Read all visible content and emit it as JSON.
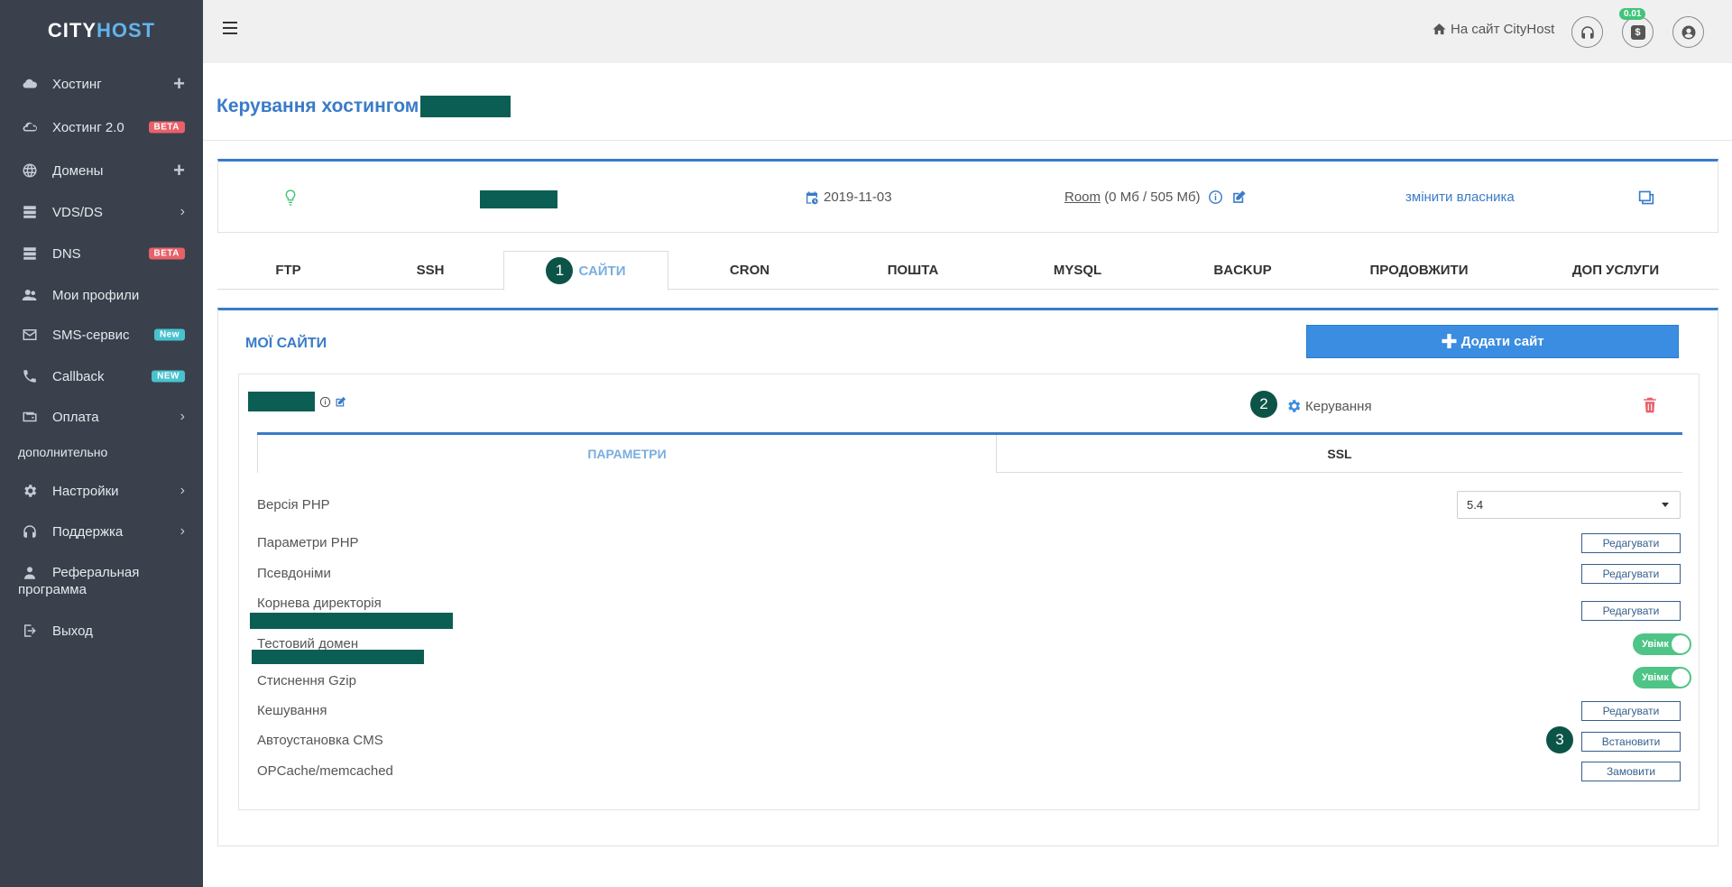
{
  "brand": {
    "part1": "CITY",
    "part2": "HOST"
  },
  "sidebar": {
    "items": [
      {
        "label": "Хостинг",
        "icon": "cloud-icon"
      },
      {
        "label": "Хостинг 2.0",
        "icon": "cloud-outline-icon",
        "badge": "BETA"
      },
      {
        "label": "Домены",
        "icon": "globe-icon"
      },
      {
        "label": "VDS/DS",
        "icon": "server-icon"
      },
      {
        "label": "DNS",
        "icon": "server-icon",
        "badge": "BETA"
      },
      {
        "label": "Мои профили",
        "icon": "users-icon"
      },
      {
        "label": "SMS-сервис",
        "icon": "envelope-icon",
        "badge": "New"
      },
      {
        "label": "Callback",
        "icon": "phone-icon",
        "badge": "NEW"
      },
      {
        "label": "Оплата",
        "icon": "wallet-icon"
      },
      {
        "label": "Настройки",
        "icon": "gear-icon"
      },
      {
        "label": "Поддержка",
        "icon": "headset-icon"
      },
      {
        "label_line1": "Реферальная",
        "label_line2": "программа",
        "icon": "referral-icon"
      },
      {
        "label": "Выход",
        "icon": "logout-icon"
      }
    ],
    "section_label": "дополнительно"
  },
  "topbar": {
    "site_link": "На сайт CityHost",
    "balance": "0.01",
    "balance_symbol": "$"
  },
  "page": {
    "title": "Керування хостингом"
  },
  "info": {
    "date": "2019-11-03",
    "plan_name": "Room",
    "plan_usage": "(0 Мб / 505 Мб)",
    "change_owner": "змінити власника"
  },
  "tabs": [
    {
      "label": "FTP"
    },
    {
      "label": "SSH"
    },
    {
      "label": "САЙТИ",
      "step": "1"
    },
    {
      "label": "CRON"
    },
    {
      "label": "ПОШТА"
    },
    {
      "label": "MYSQL"
    },
    {
      "label": "BACKUP"
    },
    {
      "label": "ПРОДОВЖИТИ"
    },
    {
      "label": "ДОП УСЛУГИ"
    }
  ],
  "sites": {
    "title": "МОЇ САЙТИ",
    "add_button": "Додати сайт",
    "manage_label": "Керування",
    "manage_step": "2",
    "subtabs": {
      "params": "ПАРАМЕТРИ",
      "ssl": "SSL"
    },
    "rows": {
      "php_version_label": "Версія PHP",
      "php_version_value": "5.4",
      "php_params_label": "Параметри PHP",
      "aliases_label": "Псевдоніми",
      "root_dir_label": "Корнева директорія",
      "test_domain_label": "Тестовий домен",
      "gzip_label": "Стиснення Gzip",
      "caching_label": "Кешування",
      "cms_label": "Автоустановка CMS",
      "cms_step": "3",
      "opcache_label": "OPCache/memcached"
    },
    "buttons": {
      "edit": "Редагувати",
      "install": "Встановити",
      "order": "Замовити"
    },
    "toggle_on": "Увімк"
  }
}
